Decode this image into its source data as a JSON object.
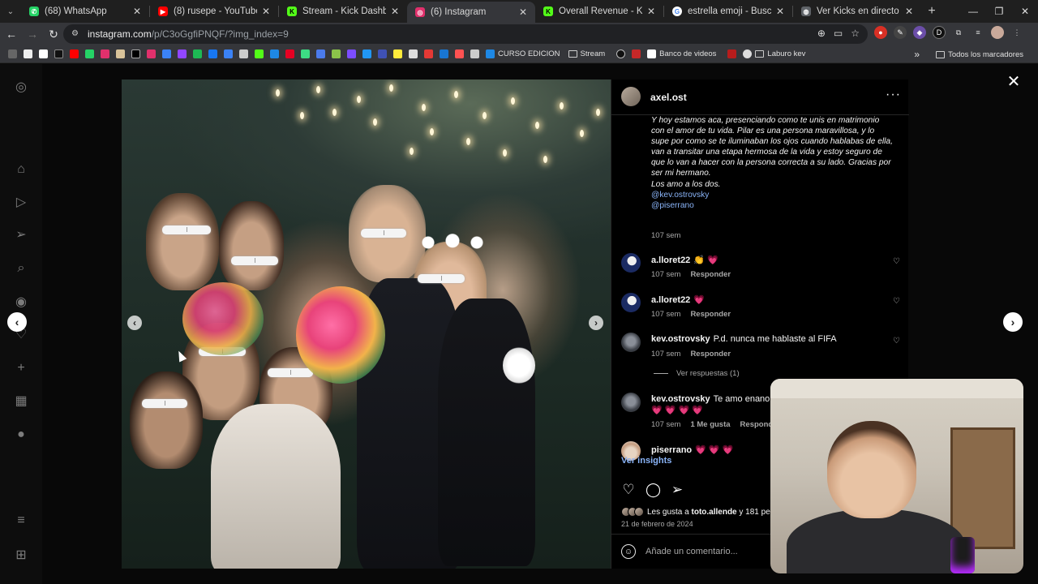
{
  "browser": {
    "tabs": [
      {
        "title": "(68) WhatsApp",
        "color": "#25d366",
        "active": false
      },
      {
        "title": "(8) rusepe - YouTube",
        "color": "#ff0000",
        "active": false
      },
      {
        "title": "Stream - Kick Dashboard",
        "color": "#53fc18",
        "active": false
      },
      {
        "title": "(6) Instagram",
        "color": "#e1306c",
        "active": true
      },
      {
        "title": "Overall Revenue - Kick Dashbo",
        "color": "#53fc18",
        "active": false
      },
      {
        "title": "estrella emoji - Buscar con Go",
        "color": "#4285f4",
        "active": false
      },
      {
        "title": "Ver Kicks en directo",
        "color": "#5f6368",
        "active": false
      }
    ],
    "url_host": "instagram.com",
    "url_path": "/p/C3oGgfiPNQF/?img_index=9",
    "bookmarks": {
      "curso_edicion": "CURSO EDICION",
      "stream": "Stream",
      "banco_videos": "Banco de videos",
      "laburo_kev": "Laburo kev",
      "todos": "Todos los marcadores"
    }
  },
  "post": {
    "author": "axel.ost",
    "caption": "Y hoy estamos aca, presenciando como te unis en matrimonio con el amor de tu vida. Pilar es una persona maravillosa, y lo supe por como se te iluminaban los ojos cuando hablabas de ella, van a transitar una etapa hermosa de la vida y estoy seguro de que lo van a hacer con la persona correcta a su lado. Gracias por ser mi hermano.",
    "caption_line2": "Los amo a los dos.",
    "mention1": "@kev.ostrovsky",
    "mention2": "@piserrano",
    "caption_time": "107 sem",
    "comments": [
      {
        "user": "a.lloret22",
        "text": "👏 💗",
        "time": "107 sem",
        "reply": "Responder"
      },
      {
        "user": "a.lloret22",
        "text": "💗",
        "time": "107 sem",
        "reply": "Responder"
      },
      {
        "user": "kev.ostrovsky",
        "text": "P.d. nunca me hablaste al FIFA",
        "time": "107 sem",
        "reply": "Responder"
      },
      {
        "user": "kev.ostrovsky",
        "text": "Te amo enano!!! Gr",
        "text2": "💗 💗 💗 💗",
        "time": "107 sem",
        "likes": "1 Me gusta",
        "reply": "Responder"
      },
      {
        "user": "piserrano",
        "text": "💗 💗 💗"
      }
    ],
    "view_replies": "Ver respuestas (1)",
    "insights": "Ver insights",
    "likes_prefix": "Les gusta a",
    "likes_user": "toto.allende",
    "likes_suffix": "y 181 pe",
    "date": "21 de febrero de 2024",
    "add_comment_placeholder": "Añade un comentario..."
  }
}
